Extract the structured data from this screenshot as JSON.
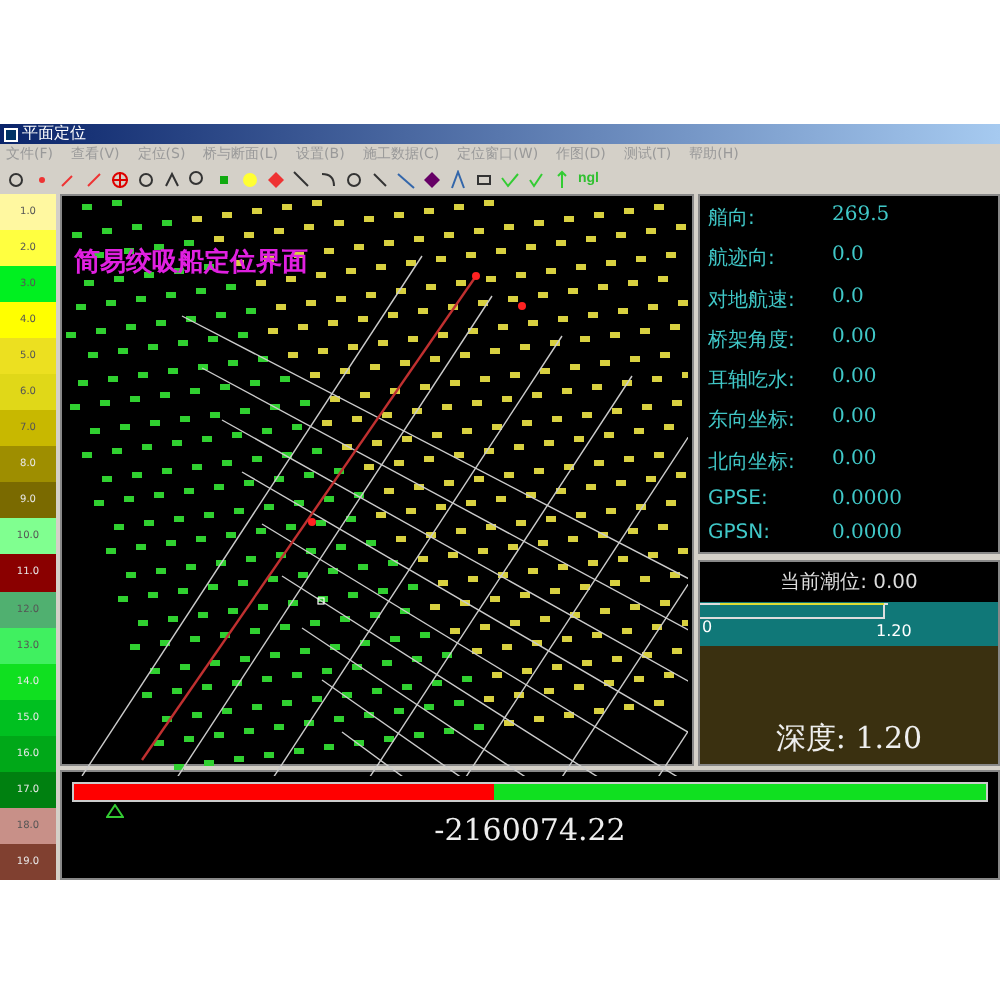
{
  "window": {
    "title": "平面定位"
  },
  "menu": [
    {
      "label": "文件(F)"
    },
    {
      "label": "查看(V)"
    },
    {
      "label": "定位(S)"
    },
    {
      "label": "桥与断面(L)"
    },
    {
      "label": "设置(B)"
    },
    {
      "label": "施工数据(C)"
    },
    {
      "label": "定位窗口(W)"
    },
    {
      "label": "作图(D)"
    },
    {
      "label": "测试(T)"
    },
    {
      "label": "帮助(H)"
    }
  ],
  "toolbar": {
    "text_button": "ngl"
  },
  "legend": [
    {
      "label": "1.0",
      "color": "#fff8a0"
    },
    {
      "label": "2.0",
      "color": "#ffff40"
    },
    {
      "label": "3.0",
      "color": "#00f020"
    },
    {
      "label": "4.0",
      "color": "#ffff00"
    },
    {
      "label": "5.0",
      "color": "#ece020"
    },
    {
      "label": "6.0",
      "color": "#e0d818"
    },
    {
      "label": "7.0",
      "color": "#c8b800"
    },
    {
      "label": "8.0",
      "color": "#9e8e00"
    },
    {
      "label": "9.0",
      "color": "#7a6a00"
    },
    {
      "label": "10.0",
      "color": "#80ff90"
    },
    {
      "label": "11.0",
      "color": "#8a0000"
    },
    {
      "label": "12.0",
      "color": "#50b070"
    },
    {
      "label": "13.0",
      "color": "#40f060"
    },
    {
      "label": "14.0",
      "color": "#10e020"
    },
    {
      "label": "15.0",
      "color": "#00c020"
    },
    {
      "label": "16.0",
      "color": "#00a818"
    },
    {
      "label": "17.0",
      "color": "#008010"
    },
    {
      "label": "18.0",
      "color": "#c89088"
    },
    {
      "label": "19.0",
      "color": "#804030"
    }
  ],
  "map": {
    "title": "简易绞吸船定位界面"
  },
  "info": [
    {
      "label": "艏向:",
      "value": "269.5"
    },
    {
      "label": "航迹向:",
      "value": "0.0"
    },
    {
      "label": "对地航速:",
      "value": "0.0"
    },
    {
      "label": "桥架角度:",
      "value": "0.00"
    },
    {
      "label": "耳轴吃水:",
      "value": "0.00"
    },
    {
      "label": "东向坐标:",
      "value": "0.00"
    },
    {
      "label": "北向坐标:",
      "value": "0.00"
    },
    {
      "label": "GPSE:",
      "value": "0.0000"
    },
    {
      "label": "GPSN:",
      "value": "0.0000"
    }
  ],
  "tide": {
    "current": "当前潮位: 0.00",
    "scale_start": "0",
    "scale_end": "1.20",
    "depth": "深度: 1.20"
  },
  "position_bar": {
    "level": 0.46,
    "reading": "-2160074.22"
  }
}
